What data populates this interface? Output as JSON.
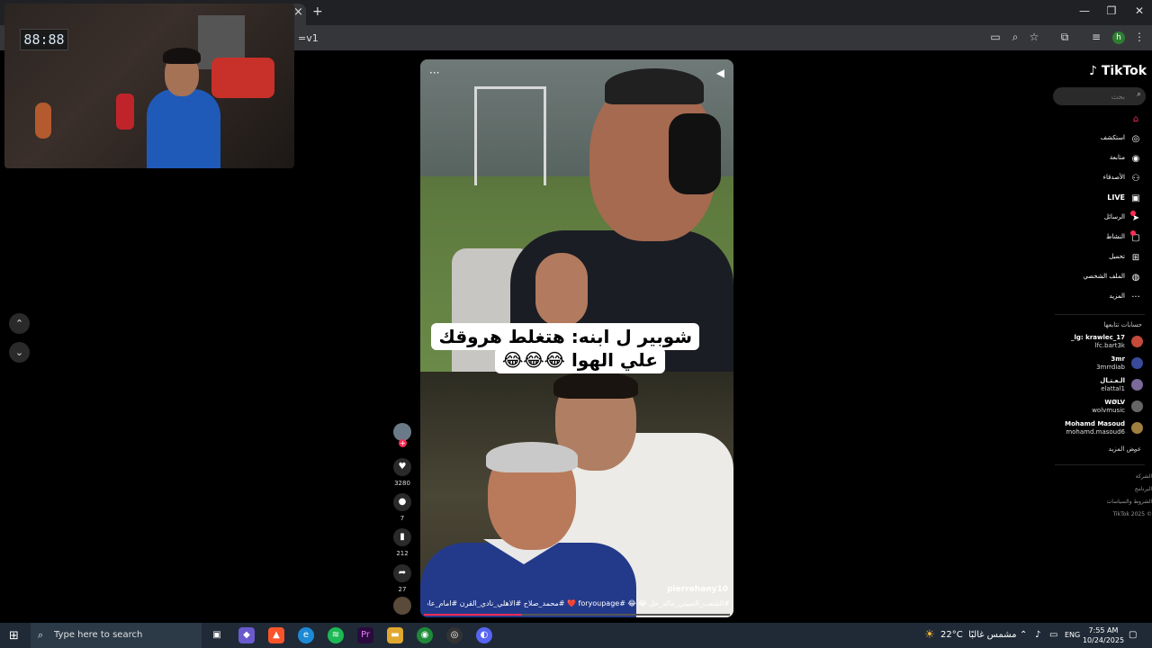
{
  "browser": {
    "new_tab_label": "+",
    "tab_close": "×",
    "url_fragment": "=v1",
    "profile_initial": "h",
    "window_buttons": {
      "minimize": "—",
      "maximize": "❐",
      "close": "✕"
    }
  },
  "webcam": {
    "clock_display": "88:88"
  },
  "nav": {
    "up": "⌃",
    "down": "⌄"
  },
  "video": {
    "menu_icon": "···",
    "sound_icon": "◀",
    "caption_line1": "شوبير ل ابنه: هتغلط هروقك",
    "caption_line2": "علي الهوا 😂😂😂",
    "watermark": "pierrehany10",
    "hashtags": "#الشعب_الصيني_ماله_حل 😂 😂 #foryoupage ❤️ #محمد_صلاح #الاهلي_نادي_القرن #امام_عاشور",
    "progress": 0.32
  },
  "actions": {
    "likes": "3280",
    "comments": "7",
    "saves": "212",
    "shares": "27",
    "follow_plus": "+"
  },
  "sidebar": {
    "logo": "TikTok",
    "search_placeholder": "بحث",
    "items": [
      {
        "label": "",
        "icon": "home-icon"
      },
      {
        "label": "استكشف",
        "icon": "compass-icon"
      },
      {
        "label": "متابعة",
        "icon": "following-icon"
      },
      {
        "label": "الأصدقاء",
        "icon": "friends-icon"
      },
      {
        "label": "LIVE",
        "icon": "live-icon"
      },
      {
        "label": "الرسائل",
        "icon": "messages-icon"
      },
      {
        "label": "النشاط",
        "icon": "activity-icon"
      },
      {
        "label": "تحميل",
        "icon": "upload-icon"
      },
      {
        "label": "الملف الشخصي",
        "icon": "profile-icon"
      },
      {
        "label": "المزيد",
        "icon": "more-icon"
      }
    ],
    "following_title": "حسابات تتابعها",
    "accounts": [
      {
        "name": "_lg: krawlec_17",
        "handle": "lfc.bart3k",
        "color": "#c44a3a"
      },
      {
        "name": "3mr",
        "handle": "3mrrdiab",
        "color": "#3a4a9a"
      },
      {
        "name": "الـعـتـال",
        "handle": "elattal1",
        "color": "#7a6a9a"
      },
      {
        "name": "WØLV",
        "handle": "wolvmusic",
        "color": "#666666"
      },
      {
        "name": "Mohamd Masoud",
        "handle": "mohamd.masoud6",
        "color": "#a08040"
      }
    ],
    "show_more": "عرض المزيد",
    "footer": [
      "الشركة",
      "البرنامج",
      "الشروط والسياسات",
      "© 2025 TikTok"
    ]
  },
  "taskbar": {
    "search_text": "Type here to search",
    "temperature": "22°C",
    "weather_text": "مشمس غالبًا",
    "language": "ENG",
    "time": "7:55 AM",
    "date": "10/24/2025"
  }
}
